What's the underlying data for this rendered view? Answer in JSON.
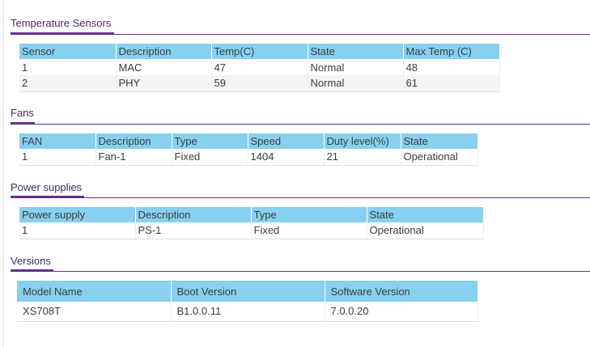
{
  "temperature": {
    "title": "Temperature Sensors",
    "headers": [
      "Sensor",
      "Description",
      "Temp(C)",
      "State",
      "Max Temp (C)"
    ],
    "rows": [
      [
        "1",
        "MAC",
        "47",
        "Normal",
        "48"
      ],
      [
        "2",
        "PHY",
        "59",
        "Normal",
        "61"
      ]
    ]
  },
  "fans": {
    "title": "Fans",
    "headers": [
      "FAN",
      "Description",
      "Type",
      "Speed",
      "Duty level(%)",
      "State"
    ],
    "rows": [
      [
        "1",
        "Fan-1",
        "Fixed",
        "1404",
        "21",
        "Operational"
      ]
    ]
  },
  "power": {
    "title": "Power supplies",
    "headers": [
      "Power supply",
      "Description",
      "Type",
      "State"
    ],
    "rows": [
      [
        "1",
        "PS-1",
        "Fixed",
        "Operational"
      ]
    ]
  },
  "versions": {
    "title": "Versions",
    "headers": [
      "Model Name",
      "Boot Version",
      "Software Version"
    ],
    "rows": [
      [
        "XS708T",
        "B1.0.0.11",
        "7.0.0.20"
      ]
    ]
  },
  "colors": {
    "header_bg": "#87d0ef",
    "section_line": "#6a2c8c"
  }
}
